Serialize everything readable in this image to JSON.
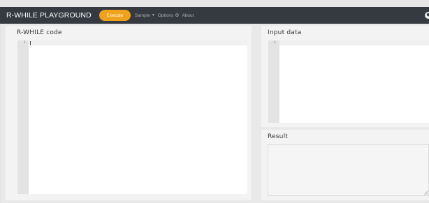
{
  "navbar": {
    "brand": "R-WHILE PLAYGROUND",
    "execute_label": "Execute",
    "sample_label": "Sample",
    "options_label": "Options",
    "about_label": "About"
  },
  "code_panel": {
    "title": "R-WHILE code",
    "line_numbers": [
      "1"
    ]
  },
  "input_panel": {
    "title": "Input data",
    "line_numbers": [
      "1"
    ]
  },
  "result_panel": {
    "title": "Result",
    "value": ""
  },
  "colors": {
    "navbar": "#343a40",
    "execute": "#f0a31a"
  }
}
